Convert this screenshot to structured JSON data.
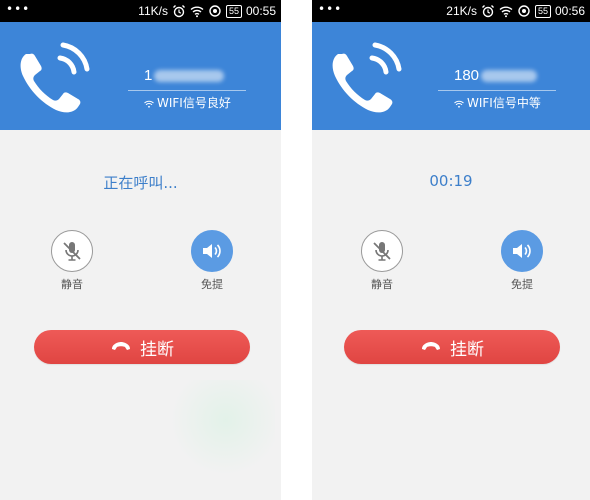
{
  "left": {
    "statusbar": {
      "menu_dots": "•••",
      "net_speed": "11K/s",
      "battery": "55",
      "time": "00:55",
      "icons": [
        "alarm-icon",
        "wifi-icon",
        "sync-icon",
        "battery-icon"
      ]
    },
    "caller": {
      "number_visible": "1",
      "signal": "WIFI信号良好"
    },
    "call_status": "正在呼叫...",
    "controls": {
      "mute_label": "静音",
      "speaker_label": "免提"
    },
    "hangup_label": "挂断"
  },
  "right": {
    "statusbar": {
      "menu_dots": "•••",
      "net_speed": "21K/s",
      "battery": "55",
      "time": "00:56",
      "icons": [
        "alarm-icon",
        "wifi-icon",
        "sync-icon",
        "battery-icon"
      ]
    },
    "caller": {
      "number_visible": "180",
      "signal": "WIFI信号中等"
    },
    "call_status": "00:19",
    "controls": {
      "mute_label": "静音",
      "speaker_label": "免提"
    },
    "hangup_label": "挂断"
  },
  "colors": {
    "header_blue": "#3d85d8",
    "status_text": "#3d7fca",
    "speaker_active": "#5b9be3",
    "hangup_red": "#e44c49",
    "background": "#f2f2f2"
  }
}
